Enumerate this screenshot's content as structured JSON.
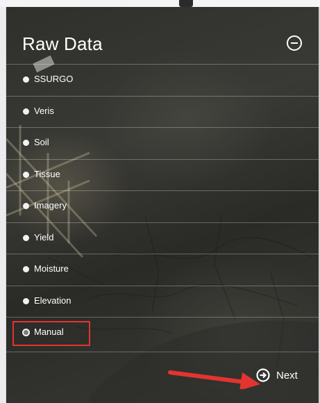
{
  "panel": {
    "title": "Raw Data",
    "collapse_icon": "minus-circle-icon"
  },
  "items": [
    {
      "label": "SSURGO",
      "selected": false
    },
    {
      "label": "Veris",
      "selected": false
    },
    {
      "label": "Soil",
      "selected": false
    },
    {
      "label": "Tissue",
      "selected": false
    },
    {
      "label": "Imagery",
      "selected": false
    },
    {
      "label": "Yield",
      "selected": false
    },
    {
      "label": "Moisture",
      "selected": false
    },
    {
      "label": "Elevation",
      "selected": false
    },
    {
      "label": "Manual",
      "selected": true
    }
  ],
  "footer": {
    "next_label": "Next",
    "next_icon": "arrow-right-circle-icon"
  },
  "annotation": {
    "highlight_color": "#e3342f",
    "arrow_color": "#e3342f"
  }
}
